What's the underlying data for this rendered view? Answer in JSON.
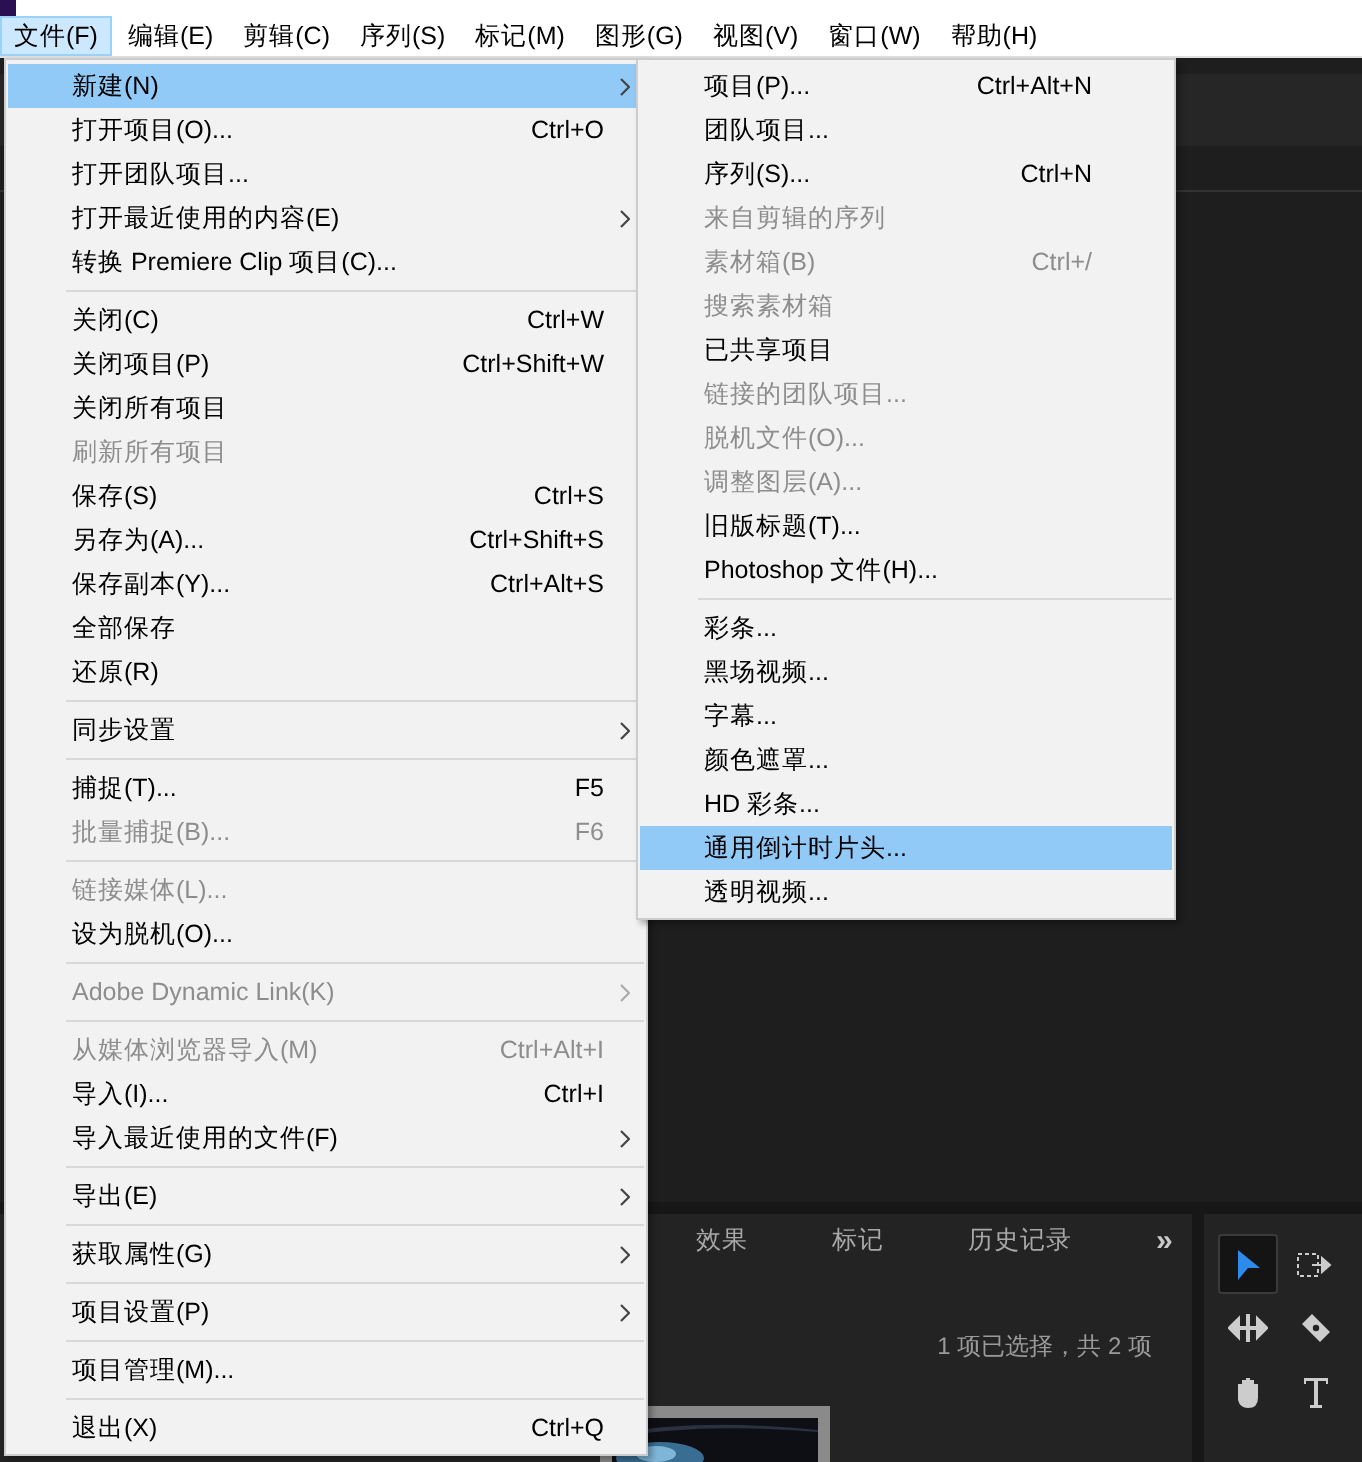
{
  "menubar": [
    {
      "label": "文件(F)",
      "selected": true
    },
    {
      "label": "编辑(E)",
      "selected": false
    },
    {
      "label": "剪辑(C)",
      "selected": false
    },
    {
      "label": "序列(S)",
      "selected": false
    },
    {
      "label": "标记(M)",
      "selected": false
    },
    {
      "label": "图形(G)",
      "selected": false
    },
    {
      "label": "视图(V)",
      "selected": false
    },
    {
      "label": "窗口(W)",
      "selected": false
    },
    {
      "label": "帮助(H)",
      "selected": false
    }
  ],
  "file_menu": {
    "items": [
      {
        "kind": "item",
        "label": "新建(N)",
        "submenu": true,
        "disabled": false,
        "selected": true
      },
      {
        "kind": "item",
        "label": "打开项目(O)...",
        "shortcut": "Ctrl+O",
        "submenu": false,
        "disabled": false,
        "selected": false
      },
      {
        "kind": "item",
        "label": "打开团队项目...",
        "submenu": false,
        "disabled": false,
        "selected": false
      },
      {
        "kind": "item",
        "label": "打开最近使用的内容(E)",
        "submenu": true,
        "disabled": false,
        "selected": false
      },
      {
        "kind": "item",
        "label": "转换 Premiere Clip 项目(C)...",
        "submenu": false,
        "disabled": false,
        "selected": false
      },
      {
        "kind": "separator"
      },
      {
        "kind": "item",
        "label": "关闭(C)",
        "shortcut": "Ctrl+W",
        "submenu": false,
        "disabled": false,
        "selected": false
      },
      {
        "kind": "item",
        "label": "关闭项目(P)",
        "shortcut": "Ctrl+Shift+W",
        "submenu": false,
        "disabled": false,
        "selected": false
      },
      {
        "kind": "item",
        "label": "关闭所有项目",
        "submenu": false,
        "disabled": false,
        "selected": false
      },
      {
        "kind": "item",
        "label": "刷新所有项目",
        "submenu": false,
        "disabled": true,
        "selected": false
      },
      {
        "kind": "item",
        "label": "保存(S)",
        "shortcut": "Ctrl+S",
        "submenu": false,
        "disabled": false,
        "selected": false
      },
      {
        "kind": "item",
        "label": "另存为(A)...",
        "shortcut": "Ctrl+Shift+S",
        "submenu": false,
        "disabled": false,
        "selected": false
      },
      {
        "kind": "item",
        "label": "保存副本(Y)...",
        "shortcut": "Ctrl+Alt+S",
        "submenu": false,
        "disabled": false,
        "selected": false
      },
      {
        "kind": "item",
        "label": "全部保存",
        "submenu": false,
        "disabled": false,
        "selected": false
      },
      {
        "kind": "item",
        "label": "还原(R)",
        "submenu": false,
        "disabled": false,
        "selected": false
      },
      {
        "kind": "separator"
      },
      {
        "kind": "item",
        "label": "同步设置",
        "submenu": true,
        "disabled": false,
        "selected": false
      },
      {
        "kind": "separator"
      },
      {
        "kind": "item",
        "label": "捕捉(T)...",
        "shortcut": "F5",
        "submenu": false,
        "disabled": false,
        "selected": false
      },
      {
        "kind": "item",
        "label": "批量捕捉(B)...",
        "shortcut": "F6",
        "submenu": false,
        "disabled": true,
        "selected": false
      },
      {
        "kind": "separator"
      },
      {
        "kind": "item",
        "label": "链接媒体(L)...",
        "submenu": false,
        "disabled": true,
        "selected": false
      },
      {
        "kind": "item",
        "label": "设为脱机(O)...",
        "submenu": false,
        "disabled": false,
        "selected": false
      },
      {
        "kind": "separator"
      },
      {
        "kind": "item",
        "label": "Adobe Dynamic Link(K)",
        "submenu": true,
        "disabled": true,
        "selected": false
      },
      {
        "kind": "separator"
      },
      {
        "kind": "item",
        "label": "从媒体浏览器导入(M)",
        "shortcut": "Ctrl+Alt+I",
        "submenu": false,
        "disabled": true,
        "selected": false
      },
      {
        "kind": "item",
        "label": "导入(I)...",
        "shortcut": "Ctrl+I",
        "submenu": false,
        "disabled": false,
        "selected": false
      },
      {
        "kind": "item",
        "label": "导入最近使用的文件(F)",
        "submenu": true,
        "disabled": false,
        "selected": false
      },
      {
        "kind": "separator"
      },
      {
        "kind": "item",
        "label": "导出(E)",
        "submenu": true,
        "disabled": false,
        "selected": false
      },
      {
        "kind": "separator"
      },
      {
        "kind": "item",
        "label": "获取属性(G)",
        "submenu": true,
        "disabled": false,
        "selected": false
      },
      {
        "kind": "separator"
      },
      {
        "kind": "item",
        "label": "项目设置(P)",
        "submenu": true,
        "disabled": false,
        "selected": false
      },
      {
        "kind": "separator"
      },
      {
        "kind": "item",
        "label": "项目管理(M)...",
        "submenu": false,
        "disabled": false,
        "selected": false
      },
      {
        "kind": "separator"
      },
      {
        "kind": "item",
        "label": "退出(X)",
        "shortcut": "Ctrl+Q",
        "submenu": false,
        "disabled": false,
        "selected": false
      }
    ]
  },
  "new_submenu": {
    "items": [
      {
        "kind": "item",
        "label": "项目(P)...",
        "shortcut": "Ctrl+Alt+N",
        "disabled": false,
        "selected": false
      },
      {
        "kind": "item",
        "label": "团队项目...",
        "disabled": false,
        "selected": false
      },
      {
        "kind": "item",
        "label": "序列(S)...",
        "shortcut": "Ctrl+N",
        "disabled": false,
        "selected": false
      },
      {
        "kind": "item",
        "label": "来自剪辑的序列",
        "disabled": true,
        "selected": false
      },
      {
        "kind": "item",
        "label": "素材箱(B)",
        "shortcut": "Ctrl+/",
        "disabled": true,
        "selected": false
      },
      {
        "kind": "item",
        "label": "搜索素材箱",
        "disabled": true,
        "selected": false
      },
      {
        "kind": "item",
        "label": "已共享项目",
        "disabled": false,
        "selected": false
      },
      {
        "kind": "item",
        "label": "链接的团队项目...",
        "disabled": true,
        "selected": false
      },
      {
        "kind": "item",
        "label": "脱机文件(O)...",
        "disabled": true,
        "selected": false
      },
      {
        "kind": "item",
        "label": "调整图层(A)...",
        "disabled": true,
        "selected": false
      },
      {
        "kind": "item",
        "label": "旧版标题(T)...",
        "disabled": false,
        "selected": false
      },
      {
        "kind": "item",
        "label": "Photoshop 文件(H)...",
        "disabled": false,
        "selected": false
      },
      {
        "kind": "separator"
      },
      {
        "kind": "item",
        "label": "彩条...",
        "disabled": false,
        "selected": false
      },
      {
        "kind": "item",
        "label": "黑场视频...",
        "disabled": false,
        "selected": false
      },
      {
        "kind": "item",
        "label": "字幕...",
        "disabled": false,
        "selected": false
      },
      {
        "kind": "item",
        "label": "颜色遮罩...",
        "disabled": false,
        "selected": false
      },
      {
        "kind": "item",
        "label": "HD 彩条...",
        "disabled": false,
        "selected": false
      },
      {
        "kind": "item",
        "label": "通用倒计时片头...",
        "disabled": false,
        "selected": true
      },
      {
        "kind": "item",
        "label": "透明视频...",
        "disabled": false,
        "selected": false
      }
    ]
  },
  "project_panel": {
    "tabs": [
      {
        "label": "效果"
      },
      {
        "label": "标记"
      },
      {
        "label": "历史记录"
      }
    ],
    "overflow": "»",
    "status": "1 项已选择，共 2 项"
  },
  "tools": [
    {
      "kind": "selection",
      "selected": true
    },
    {
      "kind": "track-select",
      "selected": false
    },
    {
      "kind": "ripple",
      "selected": false
    },
    {
      "kind": "razor",
      "selected": false
    },
    {
      "kind": "hand",
      "selected": false
    },
    {
      "kind": "type",
      "selected": false
    }
  ]
}
